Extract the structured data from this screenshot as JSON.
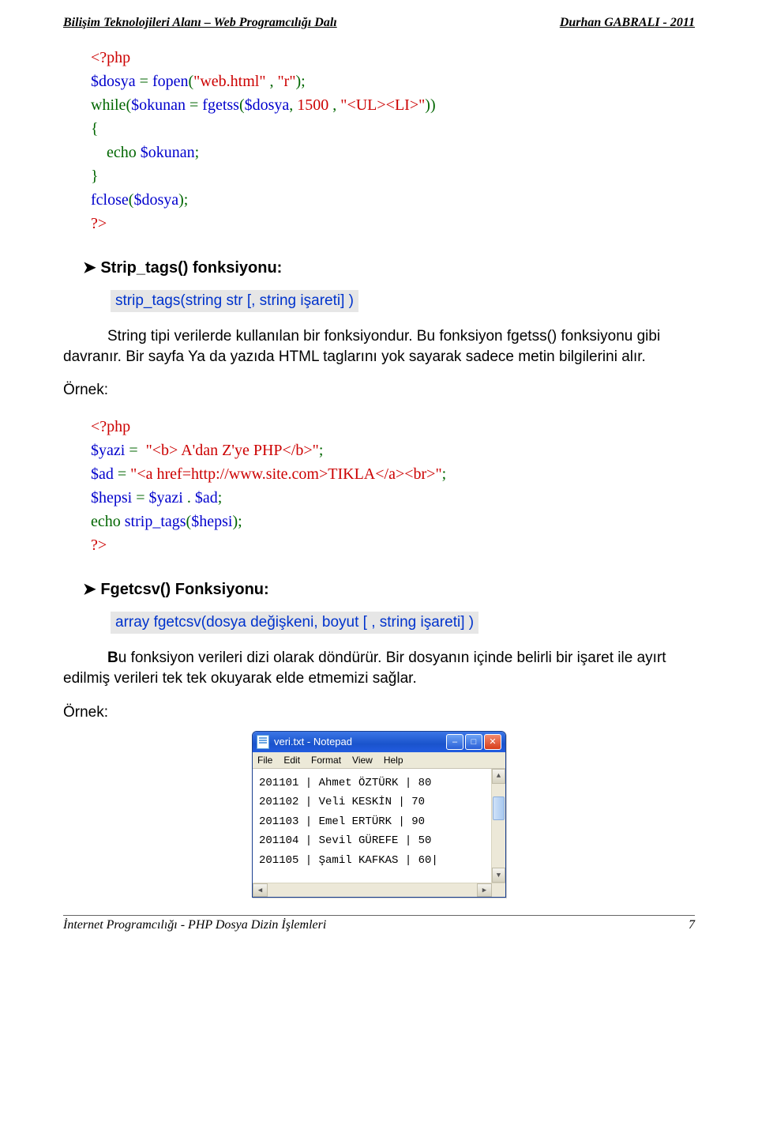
{
  "header": {
    "left": "Bilişim  Teknolojileri Alanı – Web Programcılığı Dalı",
    "right": "Durhan GABRALI  -  2011"
  },
  "code1": {
    "l1_a": "<?php",
    "l2_a": "$dosya",
    "l2_b": " = ",
    "l2_c": "fopen",
    "l2_d": "(",
    "l2_e": "\"web.html\"",
    "l2_f": " , ",
    "l2_g": "\"r\"",
    "l2_h": ");",
    "l3_a": "while",
    "l3_b": "(",
    "l3_c": "$okunan",
    "l3_d": " = ",
    "l3_e": "fgetss",
    "l3_f": "(",
    "l3_g": "$dosya",
    "l3_h": ", ",
    "l3_i": "1500",
    "l3_j": " , ",
    "l3_k": "\"<UL><LI>\"",
    "l3_l": "))",
    "l4": "{",
    "l5_a": "    echo ",
    "l5_b": "$okunan",
    "l5_c": ";",
    "l6": "}",
    "l7_a": "fclose",
    "l7_b": "(",
    "l7_c": "$dosya",
    "l7_d": ");",
    "l8": "?>"
  },
  "section1": {
    "head": "➤  Strip_tags() fonksiyonu:",
    "syntax": "strip_tags(string str [, string işareti] )",
    "p1": "String tipi verilerde kullanılan bir fonksiyondur. Bu fonksiyon fgetss() fonksiyonu gibi davranır. Bir sayfa Ya da yazıda HTML taglarını yok sayarak sadece metin bilgilerini alır.",
    "ornek": "Örnek:"
  },
  "code2": {
    "l1": "<?php",
    "l2_a": "$yazi",
    "l2_b": " =  ",
    "l2_c": "\"<b> A'dan Z'ye PHP</b>\"",
    "l2_d": ";",
    "l3_a": "$ad",
    "l3_b": " = ",
    "l3_c": "\"<a href=http://www.site.com>TIKLA</a><br>\"",
    "l3_d": ";",
    "l4_a": "$hepsi",
    "l4_b": " = ",
    "l4_c": "$yazi",
    "l4_d": " . ",
    "l4_e": "$ad",
    "l4_f": ";",
    "l5_a": "echo ",
    "l5_b": "strip_tags",
    "l5_c": "(",
    "l5_d": "$hepsi",
    "l5_e": ");",
    "l6": "?>"
  },
  "section2": {
    "head": "➤  Fgetcsv() Fonksiyonu:",
    "syntax": "array  fgetcsv(dosya değişkeni, boyut  [ , string işareti] )",
    "p1_b": "B",
    "p1_rest": "u fonksiyon verileri dizi olarak döndürür. Bir dosyanın içinde belirli bir işaret ile ayırt edilmiş verileri tek tek okuyarak elde etmemizi sağlar.",
    "ornek": "Örnek:"
  },
  "notepad": {
    "title": "veri.txt - Notepad",
    "menu": [
      "File",
      "Edit",
      "Format",
      "View",
      "Help"
    ],
    "lines": [
      "201101 | Ahmet ÖZTÜRK | 80",
      "201102 | Veli KESKİN | 70",
      "201103 | Emel ERTÜRK | 90",
      "201104 | Sevil GÜREFE | 50",
      "201105 | Şamil KAFKAS | 60|"
    ]
  },
  "footer": {
    "left": "İnternet Programcılığı  - PHP Dosya Dizin İşlemleri",
    "right": "7"
  }
}
